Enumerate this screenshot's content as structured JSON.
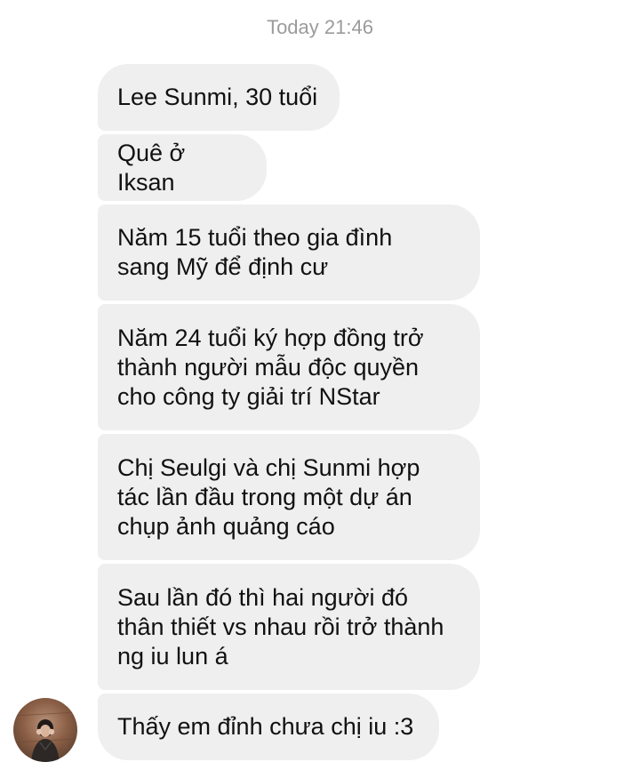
{
  "chat": {
    "timestamp": "Today 21:46",
    "messages": [
      {
        "text": "Lee Sunmi, 30 tuổi"
      },
      {
        "text": "Quê ở Iksan"
      },
      {
        "text": "Năm 15 tuổi theo gia đình\nsang Mỹ để định cư"
      },
      {
        "text": "Năm 24 tuổi ký hợp đồng trở\nthành người mẫu độc quyền\ncho công ty giải trí NStar"
      },
      {
        "text": "Chị Seulgi và chị Sunmi hợp\ntác lần đầu trong một dự án\nchụp ảnh quảng cáo"
      },
      {
        "text": "Sau lần đó thì hai người đó\nthân thiết vs nhau rồi trở thành\nng iu lun á"
      },
      {
        "text": "Thấy em đỉnh chưa chị iu :3"
      }
    ],
    "sender_avatar_icon": "profile-photo-avatar",
    "colors": {
      "bubble_bg": "#efefef",
      "timestamp": "#9b9b9b",
      "text": "#111111"
    }
  }
}
